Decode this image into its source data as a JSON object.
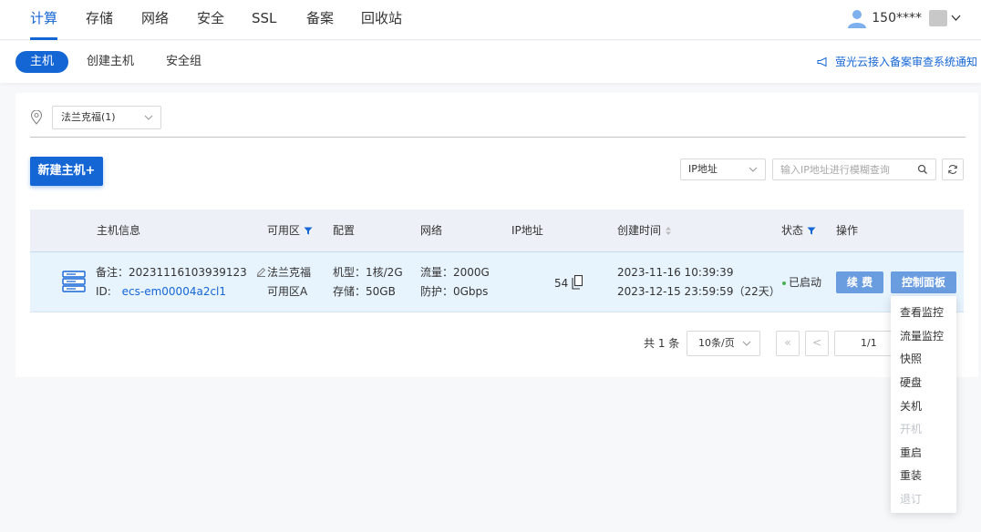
{
  "topnav": {
    "tabs": [
      {
        "label": "计算",
        "active": true
      },
      {
        "label": "存储"
      },
      {
        "label": "网络"
      },
      {
        "label": "安全"
      },
      {
        "label": "SSL"
      },
      {
        "label": "备案"
      },
      {
        "label": "回收站"
      }
    ],
    "user_label": "150****"
  },
  "subnav": {
    "tabs": [
      {
        "label": "主机",
        "active": true
      },
      {
        "label": "创建主机"
      },
      {
        "label": "安全组"
      }
    ],
    "notice": "萤光云接入备案审查系统通知"
  },
  "filters": {
    "region": "法兰克福(1)",
    "new_button": "新建主机+",
    "ip_type": "IP地址",
    "search_placeholder": "输入IP地址进行模糊查询"
  },
  "table": {
    "headers": {
      "info": "主机信息",
      "zone": "可用区",
      "config": "配置",
      "network": "网络",
      "ip": "IP地址",
      "created": "创建时间",
      "status": "状态",
      "actions": "操作"
    },
    "row": {
      "remark": "备注：20231116103939123",
      "id_label": "ID:",
      "id_value": "ecs-em00004a2cl1",
      "zone_name": "法兰克福",
      "zone_sub": "可用区A",
      "config_model": "机型：1核/2G",
      "config_storage": "存储：50GB",
      "net_traffic": "流量：2000G",
      "net_protect": "防护：0Gbps",
      "ip_tail": "54",
      "created_at": "2023-11-16 10:39:39",
      "expires_at": "2023-12-15 23:59:59（22天）",
      "status": "已启动",
      "renew_label": "续 费",
      "control_label": "控制面板"
    }
  },
  "pagination": {
    "total": "共 1 条",
    "page_size": "10条/页",
    "first": "«",
    "prev": "<",
    "page": "1/1"
  },
  "menu": {
    "items": [
      {
        "label": "查看监控"
      },
      {
        "label": "流量监控"
      },
      {
        "label": "快照"
      },
      {
        "label": "硬盘"
      },
      {
        "label": "关机"
      },
      {
        "label": "开机",
        "disabled": true
      },
      {
        "label": "重启"
      },
      {
        "label": "重装"
      },
      {
        "label": "退订",
        "disabled": true
      }
    ]
  },
  "colors": {
    "primary": "#1566d5",
    "row_highlight": "#e7f3fd",
    "button_light": "#6a9ce0",
    "status_ok": "#4caf50"
  }
}
